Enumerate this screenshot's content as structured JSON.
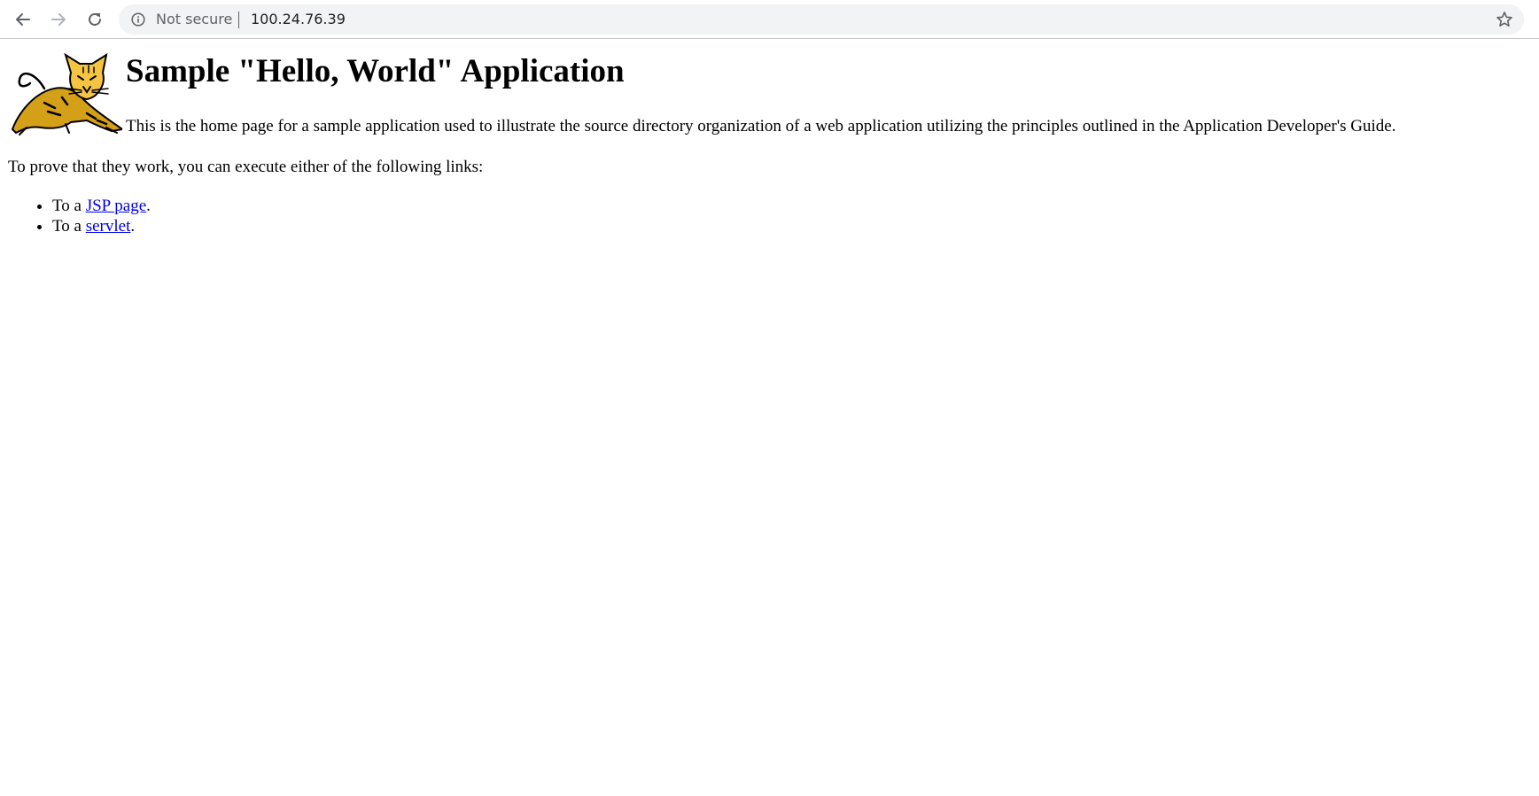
{
  "browser": {
    "security_label": "Not secure",
    "url": "100.24.76.39",
    "icons": {
      "back": "back-arrow-icon",
      "forward": "forward-arrow-icon",
      "reload": "reload-icon",
      "info": "info-icon",
      "bookmark": "star-icon"
    }
  },
  "page": {
    "heading": "Sample \"Hello, World\" Application",
    "intro": "This is the home page for a sample application used to illustrate the source directory organization of a web application utilizing the principles outlined in the Application Developer's Guide.",
    "prove_text": "To prove that they work, you can execute either of the following links:",
    "links": [
      {
        "prefix": "To a ",
        "label": "JSP page",
        "suffix": "."
      },
      {
        "prefix": "To a ",
        "label": "servlet",
        "suffix": "."
      }
    ],
    "link_color": "#0000ee"
  }
}
